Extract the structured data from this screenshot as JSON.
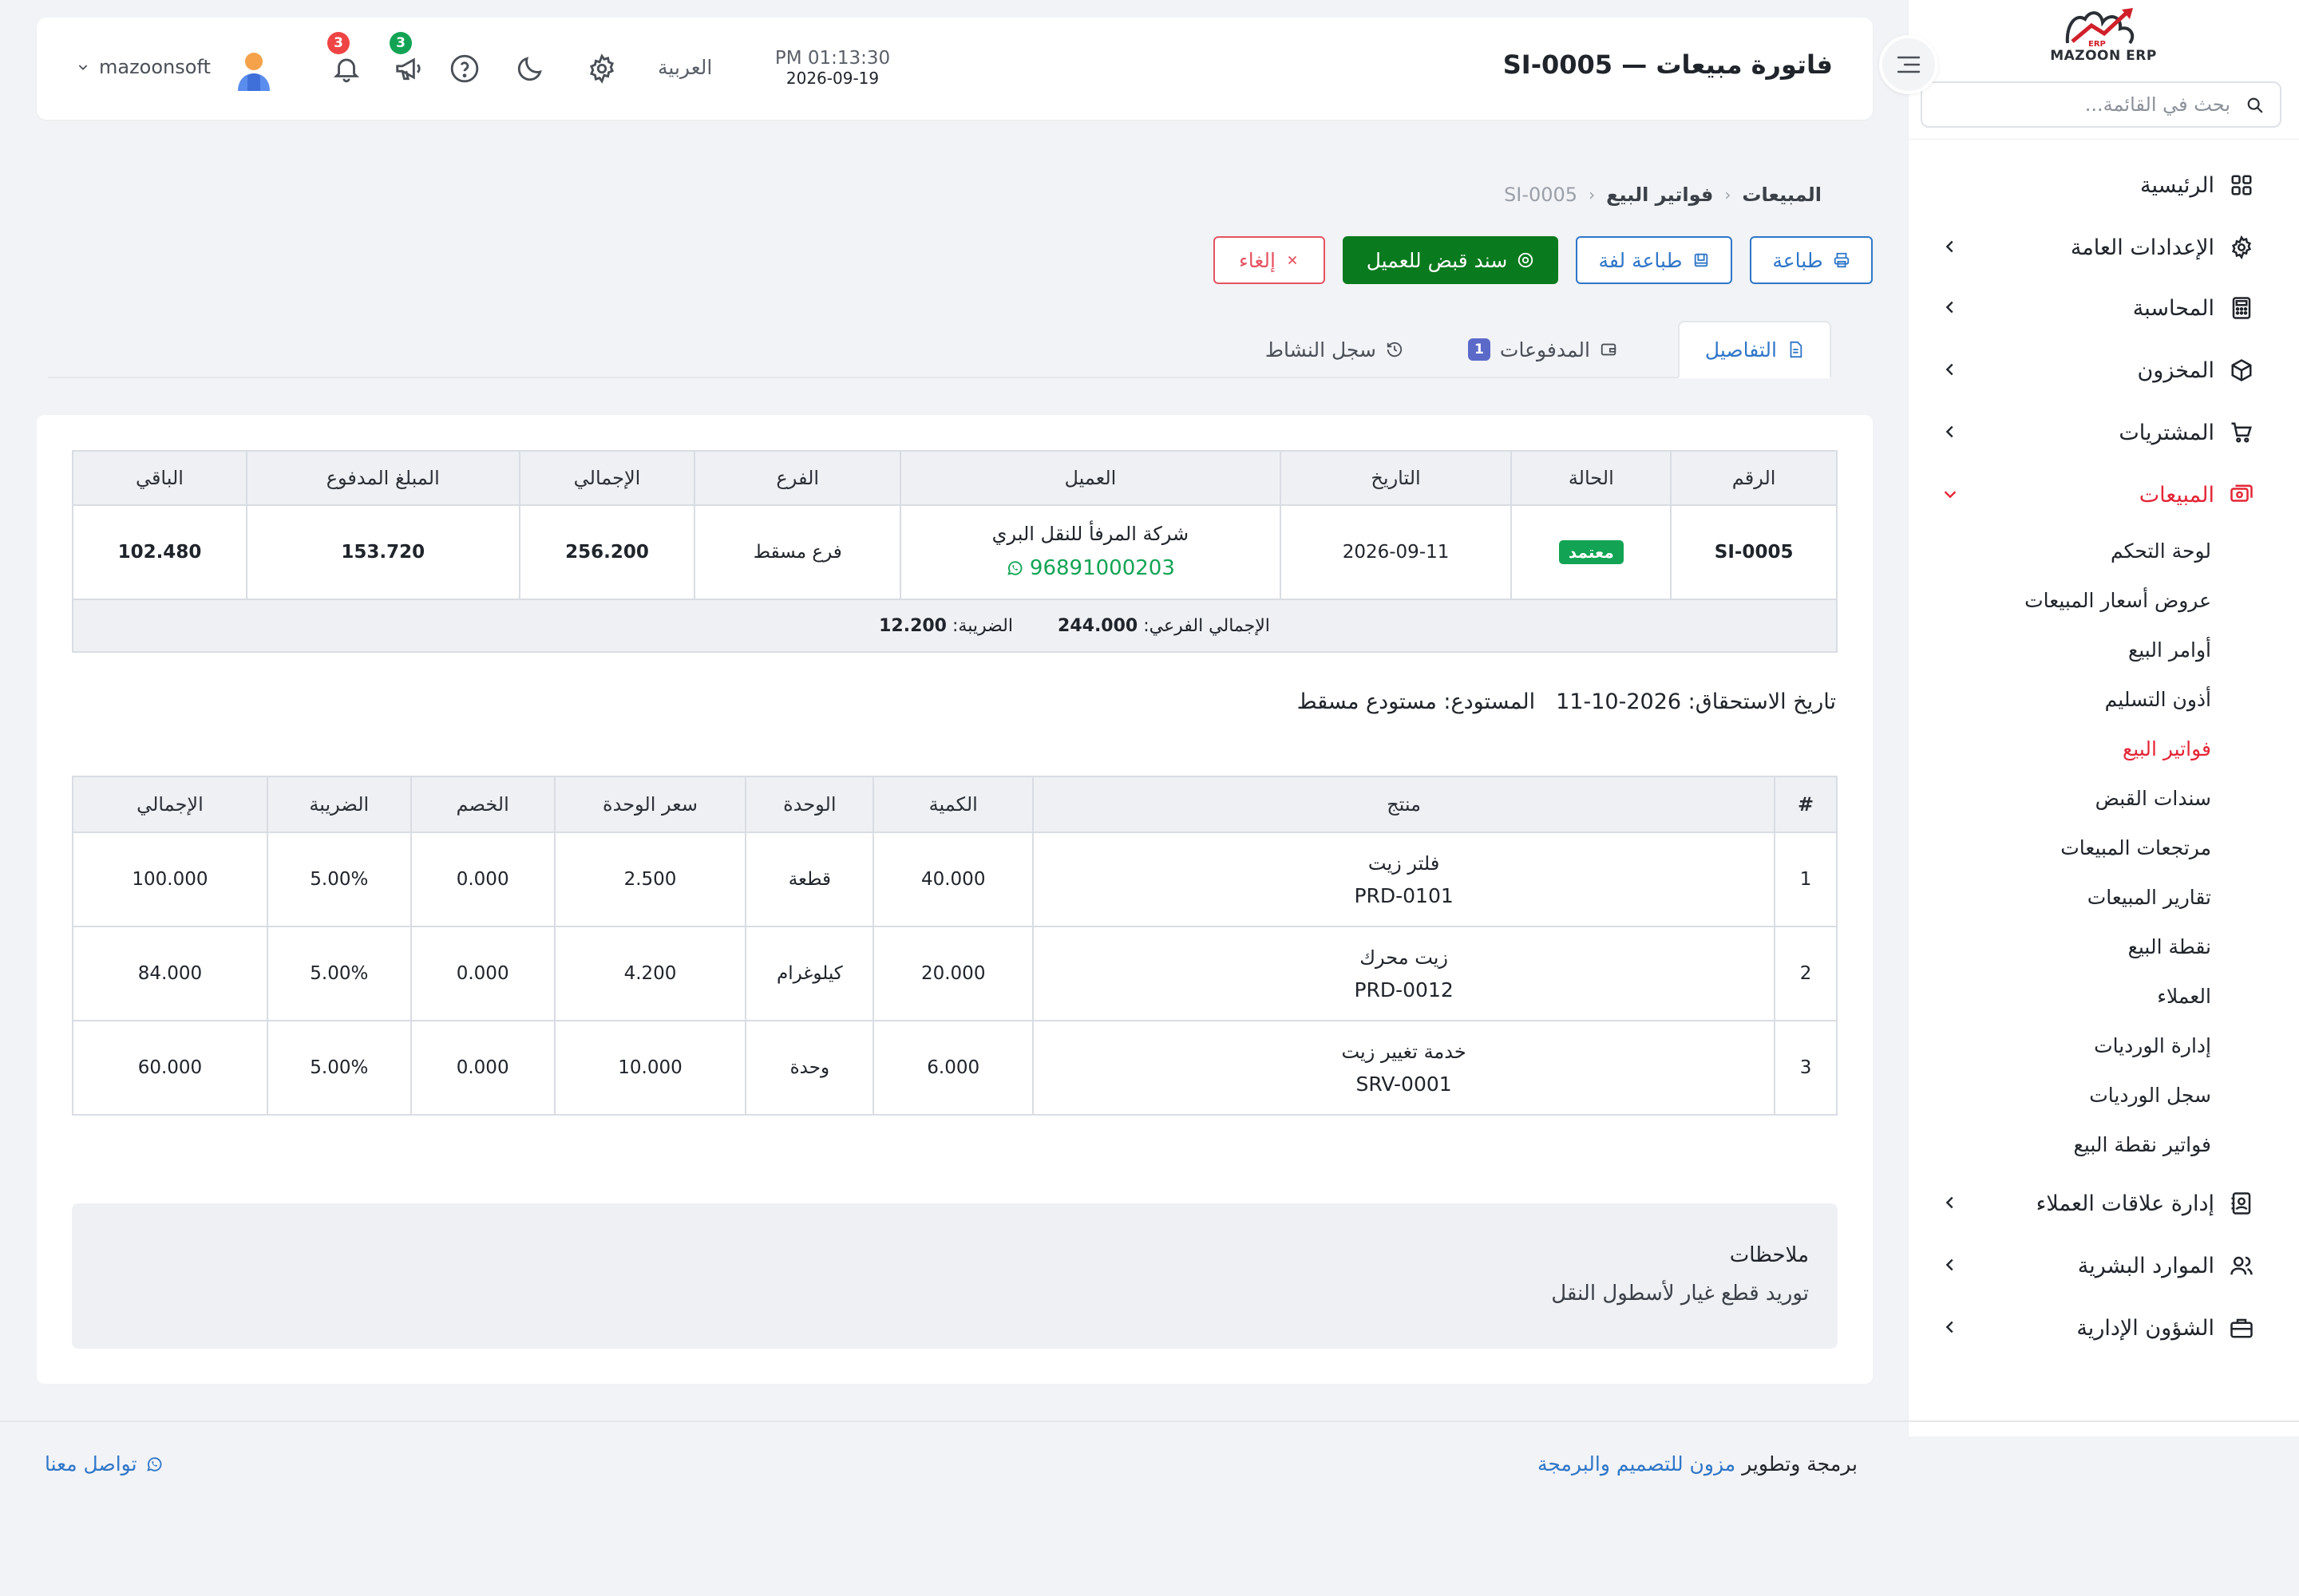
{
  "sidebar": {
    "logo_text": "MAZOON ERP",
    "logo_small": "ERP",
    "search_placeholder": "بحث في القائمة...",
    "menu": [
      {
        "label": "الرئيسية",
        "icon": "dashboard-grid-icon",
        "has_chevron": false
      },
      {
        "label": "الإعدادات العامة",
        "icon": "gear-icon",
        "has_chevron": true
      },
      {
        "label": "المحاسبة",
        "icon": "calculator-icon",
        "has_chevron": true
      },
      {
        "label": "المخزون",
        "icon": "box-icon",
        "has_chevron": true
      },
      {
        "label": "المشتريات",
        "icon": "cart-icon",
        "has_chevron": true
      },
      {
        "label": "المبيعات",
        "icon": "sales-icon",
        "has_chevron": true,
        "expanded": true
      }
    ],
    "sales_submenu": [
      "لوحة التحكم",
      "عروض أسعار المبيعات",
      "أوامر البيع",
      "أذون التسليم",
      "فواتير البيع",
      "سندات القبض",
      "مرتجعات المبيعات",
      "تقارير المبيعات",
      "نقطة البيع",
      "العملاء",
      "إدارة الورديات",
      "سجل الورديات",
      "فواتير نقطة البيع"
    ],
    "active_submenu": "فواتير البيع",
    "menu_bottom": [
      {
        "label": "إدارة علاقات العملاء",
        "icon": "contacts-icon"
      },
      {
        "label": "الموارد البشرية",
        "icon": "users-icon"
      },
      {
        "label": "الشؤون الإدارية",
        "icon": "briefcase-icon"
      }
    ]
  },
  "header": {
    "title": "فاتورة مبيعات — SI-0005",
    "time": "PM 01:13:30",
    "date": "2026-09-19",
    "language": "العربية",
    "notifications_count": "3",
    "announcements_count": "3",
    "username": "mazoonsoft"
  },
  "breadcrumb": {
    "level1": "المبيعات",
    "level2": "فواتير البيع",
    "current": "SI-0005"
  },
  "actions": {
    "print": "طباعة",
    "print_roll": "طباعة لفة",
    "receipt": "سند قبض للعميل",
    "cancel": "إلغاء"
  },
  "tabs": {
    "details": "التفاصيل",
    "payments": "المدفوعات",
    "payments_count": "1",
    "activity": "سجل النشاط"
  },
  "summary": {
    "headers": [
      "الرقم",
      "الحالة",
      "التاريخ",
      "العميل",
      "الفرع",
      "الإجمالي",
      "المبلغ المدفوع",
      "الباقي"
    ],
    "number": "SI-0005",
    "status": "معتمد",
    "date": "2026-09-11",
    "customer_name": "شركة المرفأ للنقل البري",
    "customer_phone": "96891000203",
    "branch": "فرع مسقط",
    "total": "256.200",
    "paid": "153.720",
    "remaining": "102.480",
    "subtotal_label": "الإجمالي الفرعي:",
    "subtotal_value": "244.000",
    "tax_label": "الضريبة:",
    "tax_value": "12.200"
  },
  "meta": {
    "due_label": "تاريخ الاستحقاق:",
    "due_value": "2026-10-11",
    "warehouse_label": "المستودع:",
    "warehouse_value": "مستودع مسقط"
  },
  "items": {
    "headers": [
      "#",
      "منتج",
      "الكمية",
      "الوحدة",
      "سعر الوحدة",
      "الخصم",
      "الضريبة",
      "الإجمالي"
    ],
    "rows": [
      {
        "idx": "1",
        "name": "فلتر زيت",
        "code": "PRD-0101",
        "qty": "40.000",
        "unit": "قطعة",
        "price": "2.500",
        "discount": "0.000",
        "tax": "5.00%",
        "total": "100.000"
      },
      {
        "idx": "2",
        "name": "زيت محرك",
        "code": "PRD-0012",
        "qty": "20.000",
        "unit": "كيلوغرام",
        "price": "4.200",
        "discount": "0.000",
        "tax": "5.00%",
        "total": "84.000"
      },
      {
        "idx": "3",
        "name": "خدمة تغيير زيت",
        "code": "SRV-0001",
        "qty": "6.000",
        "unit": "وحدة",
        "price": "10.000",
        "discount": "0.000",
        "tax": "5.00%",
        "total": "60.000"
      }
    ]
  },
  "notes": {
    "title": "ملاحظات",
    "body": "توريد قطع غيار لأسطول النقل"
  },
  "footer": {
    "credit_prefix": "برمجة وتطوير",
    "credit_link": "مزون للتصميم والبرمجة",
    "contact": "تواصل معنا"
  },
  "colors": {
    "accent_blue": "#2f76c8",
    "active_red": "#e32636",
    "success_green": "#12a454",
    "button_green": "#0a7a1e",
    "paid_yellow": "#f4b400"
  }
}
